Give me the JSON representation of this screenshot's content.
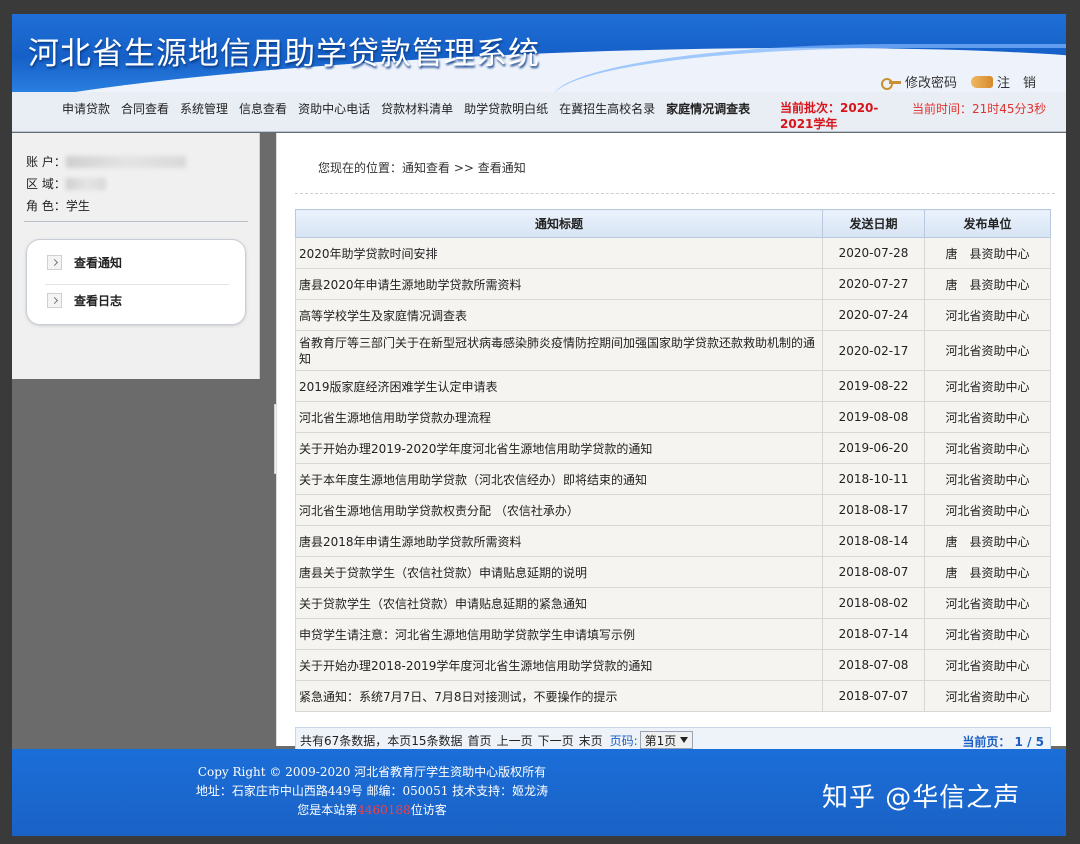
{
  "header": {
    "title": "河北省生源地信用助学贷款管理系统",
    "change_password": "修改密码",
    "logout": "注　销"
  },
  "nav": {
    "items": [
      "申请贷款",
      "合同查看",
      "系统管理",
      "信息查看",
      "资助中心电话",
      "贷款材料清单",
      "助学贷款明白纸",
      "在冀招生高校名录",
      "家庭情况调查表"
    ],
    "batch_label": "当前批次：2020-2021学年",
    "time_label": "当前时间：21时45分3秒"
  },
  "sidebar": {
    "account_label": "账 户：",
    "region_label": "区 域：",
    "role_label": "角 色：",
    "role_value": "学生",
    "menu": [
      {
        "label": "查看通知",
        "icon": "chevron-right-icon"
      },
      {
        "label": "查看日志",
        "icon": "chevron-right-icon"
      }
    ]
  },
  "main": {
    "location": "您现在的位置：通知查看 >> 查看通知",
    "columns": [
      "通知标题",
      "发送日期",
      "发布单位"
    ],
    "rows": [
      {
        "title": "2020年助学贷款时间安排",
        "date": "2020-07-28",
        "unit": "唐　县资助中心"
      },
      {
        "title": "唐县2020年申请生源地助学贷款所需资料",
        "date": "2020-07-27",
        "unit": "唐　县资助中心"
      },
      {
        "title": "高等学校学生及家庭情况调查表",
        "date": "2020-07-24",
        "unit": "河北省资助中心"
      },
      {
        "title": "省教育厅等三部门关于在新型冠状病毒感染肺炎疫情防控期间加强国家助学贷款还款救助机制的通知",
        "date": "2020-02-17",
        "unit": "河北省资助中心"
      },
      {
        "title": "2019版家庭经济困难学生认定申请表",
        "date": "2019-08-22",
        "unit": "河北省资助中心"
      },
      {
        "title": "河北省生源地信用助学贷款办理流程",
        "date": "2019-08-08",
        "unit": "河北省资助中心"
      },
      {
        "title": "关于开始办理2019-2020学年度河北省生源地信用助学贷款的通知",
        "date": "2019-06-20",
        "unit": "河北省资助中心"
      },
      {
        "title": "关于本年度生源地信用助学贷款（河北农信经办）即将结束的通知",
        "date": "2018-10-11",
        "unit": "河北省资助中心"
      },
      {
        "title": "河北省生源地信用助学贷款权责分配 （农信社承办）",
        "date": "2018-08-17",
        "unit": "河北省资助中心"
      },
      {
        "title": "唐县2018年申请生源地助学贷款所需资料",
        "date": "2018-08-14",
        "unit": "唐　县资助中心"
      },
      {
        "title": "唐县关于贷款学生（农信社贷款）申请贴息延期的说明",
        "date": "2018-08-07",
        "unit": "唐　县资助中心"
      },
      {
        "title": "关于贷款学生（农信社贷款）申请贴息延期的紧急通知",
        "date": "2018-08-02",
        "unit": "河北省资助中心"
      },
      {
        "title": "申贷学生请注意：河北省生源地信用助学贷款学生申请填写示例",
        "date": "2018-07-14",
        "unit": "河北省资助中心"
      },
      {
        "title": "关于开始办理2018-2019学年度河北省生源地信用助学贷款的通知",
        "date": "2018-07-08",
        "unit": "河北省资助中心"
      },
      {
        "title": "紧急通知：系统7月7日、7月8日对接测试，不要操作的提示",
        "date": "2018-07-07",
        "unit": "河北省资助中心"
      }
    ],
    "pager": {
      "summary": "共有67条数据，本页15条数据",
      "first": "首页",
      "prev": "上一页",
      "next": "下一页",
      "last": "末页",
      "page_label": "页码:",
      "page_select": "第1页",
      "current": "当前页： 1 / 5"
    }
  },
  "footer": {
    "copyright": "Copy Right © 2009-2020  河北省教育厅学生资助中心版权所有",
    "address": "地址：石家庄市中山西路449号 邮编：050051  技术支持：姬龙涛",
    "visitor_prefix": "您是本站第",
    "visitor_count": "4460188",
    "visitor_suffix": "位访客",
    "watermark": "知乎 @华信之声"
  }
}
